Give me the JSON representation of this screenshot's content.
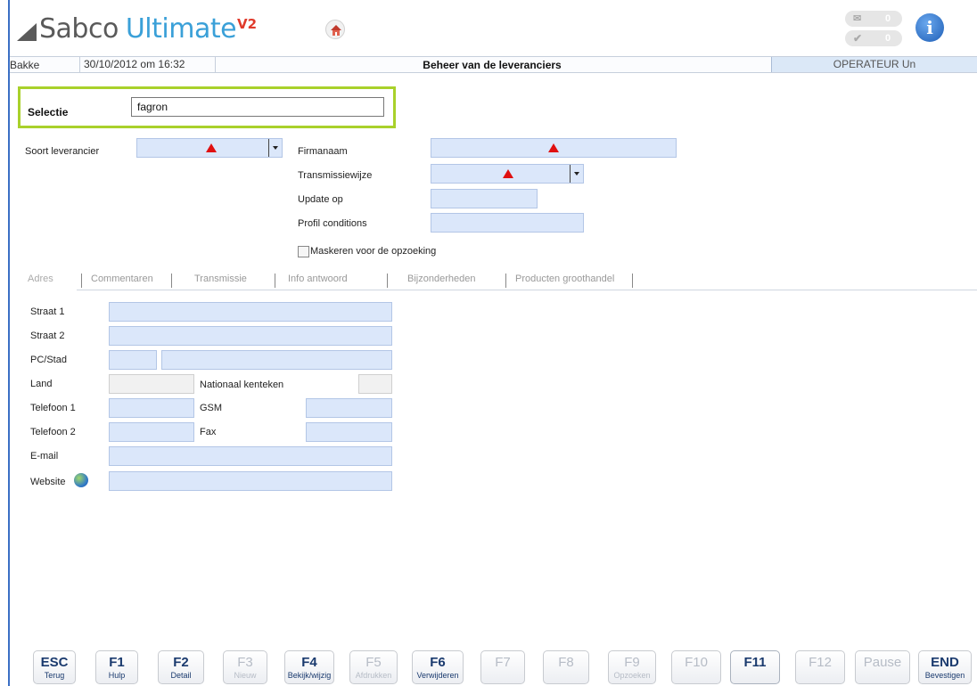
{
  "header": {
    "logo_part1": "Sabco",
    "logo_part2": "Ultimate",
    "logo_sup": "V2",
    "mail_count": "0",
    "check_count": "0",
    "info_glyph": "i"
  },
  "statusbar": {
    "user": "Bakke",
    "datetime": "30/10/2012 om 16:32",
    "title": "Beheer van de leveranciers",
    "operator": "OPERATEUR Un"
  },
  "selection": {
    "label": "Selectie",
    "value": "fagron"
  },
  "filters": {
    "soort_label": "Soort leverancier",
    "firmanaam_label": "Firmanaam",
    "transmissie_label": "Transmissiewijze",
    "update_label": "Update op",
    "profil_label": "Profil conditions",
    "mask_label": "Maskeren voor de opzoeking"
  },
  "tabs": [
    {
      "label": "Adres"
    },
    {
      "label": "Commentaren"
    },
    {
      "label": "Transmissie"
    },
    {
      "label": "Info antwoord"
    },
    {
      "label": "Bijzonderheden"
    },
    {
      "label": "Producten groothandel"
    }
  ],
  "address": {
    "straat1": "Straat 1",
    "straat2": "Straat 2",
    "pcstad": "PC/Stad",
    "land": "Land",
    "nationaal": "Nationaal kenteken",
    "tel1": "Telefoon 1",
    "gsm": "GSM",
    "tel2": "Telefoon 2",
    "fax": "Fax",
    "email": "E-mail",
    "website": "Website"
  },
  "fkeys": [
    {
      "key": "ESC",
      "sub": "Terug",
      "enabled": true
    },
    {
      "key": "F1",
      "sub": "Hulp",
      "enabled": true
    },
    {
      "key": "F2",
      "sub": "Detail",
      "enabled": true
    },
    {
      "key": "F3",
      "sub": "Nieuw",
      "enabled": false
    },
    {
      "key": "F4",
      "sub": "Bekijk/wijzig",
      "enabled": true
    },
    {
      "key": "F5",
      "sub": "Afdrukken",
      "enabled": false
    },
    {
      "key": "F6",
      "sub": "Verwijderen",
      "enabled": true
    },
    {
      "key": "F7",
      "sub": "",
      "enabled": false
    },
    {
      "key": "F8",
      "sub": "",
      "enabled": false
    },
    {
      "key": "F9",
      "sub": "Opzoeken",
      "enabled": false
    },
    {
      "key": "F10",
      "sub": "",
      "enabled": false
    },
    {
      "key": "F11",
      "sub": "",
      "enabled": true
    },
    {
      "key": "F12",
      "sub": "",
      "enabled": false
    },
    {
      "key": "Pause",
      "sub": "",
      "enabled": false
    },
    {
      "key": "END",
      "sub": "Bevestigen",
      "enabled": true
    }
  ],
  "colors": {
    "accent_green": "#a9d12b",
    "field_blue": "#dbe7fa",
    "required_red": "#e01010",
    "fkey_text": "#1a3a6e"
  }
}
